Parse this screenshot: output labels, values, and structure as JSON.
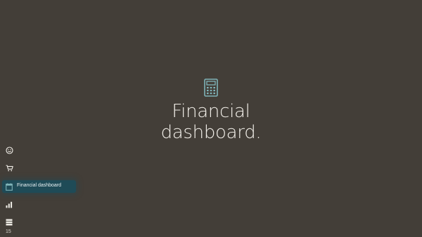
{
  "hero": {
    "title_line1": "Financial",
    "title_line2": "dashboard.",
    "icon": "calculator-icon"
  },
  "nav": {
    "items": [
      {
        "icon": "smiley-icon",
        "label": ""
      },
      {
        "icon": "cart-icon",
        "label": ""
      },
      {
        "icon": "calendar-icon",
        "label": "Financial dashboard",
        "active": true
      },
      {
        "icon": "bar-chart-icon",
        "label": ""
      },
      {
        "icon": "server-icon",
        "label": ""
      }
    ]
  },
  "footer": {
    "page_number": "15"
  },
  "colors": {
    "background": "#433e38",
    "accent": "#7fb3b8",
    "active_item": "#1f4b57",
    "text": "#f2efe9"
  }
}
